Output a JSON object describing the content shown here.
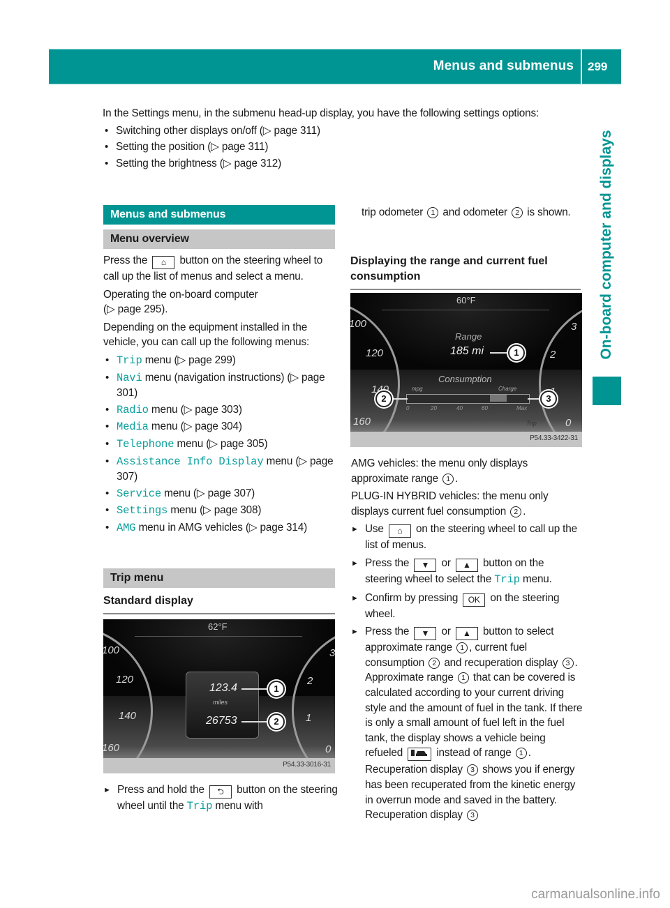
{
  "header": {
    "title": "Menus and submenus",
    "page_number": "299"
  },
  "side_tab": {
    "label": "On-board computer and displays"
  },
  "intro": {
    "paragraph": "In the Settings menu, in the submenu head-up display, you have the following settings options:",
    "items": [
      {
        "text": "Switching other displays on/off (",
        "ref": "page 311",
        "close": ")"
      },
      {
        "text": "Setting the position (",
        "ref": "page 311",
        "close": ")"
      },
      {
        "text": "Setting the brightness (",
        "ref": "page 312",
        "close": ")"
      }
    ]
  },
  "ref_marker": "▷",
  "left": {
    "section_title": "Menus and submenus",
    "subsection_title": "Menu overview",
    "p1_a": "Press the",
    "p1_b": "button on the steering wheel to call up the list of menus and select a menu.",
    "p2": "Operating the on-board computer",
    "p2_ref": "(▷ page 295).",
    "p3": "Depending on the equipment installed in the vehicle, you can call up the following menus:",
    "menus": [
      {
        "name": "Trip",
        "desc": " menu (▷ page 299)"
      },
      {
        "name": "Navi",
        "desc": " menu (navigation instructions) (▷ page 301)"
      },
      {
        "name": "Radio",
        "desc": " menu (▷ page 303)"
      },
      {
        "name": "Media",
        "desc": " menu (▷ page 304)"
      },
      {
        "name": "Telephone",
        "desc": " menu (▷ page 305)"
      },
      {
        "name": "Assistance Info Display",
        "desc": " menu (▷ page 307)"
      },
      {
        "name": "Service",
        "desc": " menu (▷ page 307)"
      },
      {
        "name": "Settings",
        "desc": " menu (▷ page 308)"
      },
      {
        "name": "AMG",
        "desc": " menu in AMG vehicles (▷ page 314)"
      }
    ],
    "trip_title": "Trip menu",
    "standard_display_title": "Standard display",
    "figure1": {
      "temperature": "62°F",
      "trip_value": "123.4",
      "unit": "miles",
      "odometer_value": "26753",
      "speed_labels": [
        "100",
        "120",
        "140",
        "160"
      ],
      "rpm_labels": [
        "3",
        "2",
        "1",
        "0"
      ],
      "callouts": [
        "1",
        "2"
      ],
      "caption": "P54.33-3016-31"
    },
    "step_a": "Press and hold the",
    "step_b": "button on the steering wheel until the",
    "step_trip": "Trip",
    "step_c": "menu with"
  },
  "right": {
    "cont_a": "trip odometer",
    "cont_b": "and odometer",
    "cont_c": "is shown.",
    "heading": "Displaying the range and current fuel consumption",
    "figure2": {
      "temperature": "60°F",
      "range_label": "Range",
      "range_value": "185 mi",
      "consumption_label": "Consumption",
      "mpg_label": "mpg",
      "charge_label": "Charge",
      "scale_labels": [
        "0",
        "20",
        "40",
        "60",
        "Max"
      ],
      "trip_label": "Trip",
      "speed_labels": [
        "100",
        "120",
        "140",
        "160"
      ],
      "rpm_labels": [
        "3",
        "2",
        "1",
        "0"
      ],
      "callouts": [
        "1",
        "2",
        "3"
      ],
      "caption": "P54.33-3422-31"
    },
    "amg_a": "AMG vehicles: the menu only displays approximate range",
    "hybrid_a": "PLUG-IN HYBRID vehicles: the menu only displays current fuel consumption",
    "s1_a": "Use",
    "s1_b": "on the steering wheel to call up the list of menus.",
    "s2_a": "Press the",
    "s2_or": "or",
    "s2_b": "button on the steering wheel to select the",
    "s2_trip": "Trip",
    "s2_c": "menu.",
    "s3_a": "Confirm by pressing",
    "s3_key": "OK",
    "s3_b": "on the steering wheel.",
    "s4_a": "Press the",
    "s4_or": "or",
    "s4_b": "button to select approximate range",
    "s4_c": ", current fuel consumption",
    "s4_d": "and recuperation display",
    "s4_e": ".",
    "p_range_a": "Approximate range",
    "p_range_b": "that can be covered is calculated according to your current driving style and the amount of fuel in the tank. If there is only a small amount of fuel left in the fuel tank, the display shows a vehicle being refueled",
    "p_range_c": "instead of range",
    "p_recup_a": "Recuperation display",
    "p_recup_b": "shows you if energy has been recuperated from the kinetic energy in overrun mode and saved in the battery. Recuperation display"
  },
  "keys": {
    "down": "▼",
    "up": "▲",
    "home": "⌂",
    "back": "⮌"
  },
  "watermark": "carmanualsonline.info",
  "colors": {
    "teal": "#009593",
    "menu_link": "#0a9f9c",
    "grey_band": "#c6c6c6"
  }
}
